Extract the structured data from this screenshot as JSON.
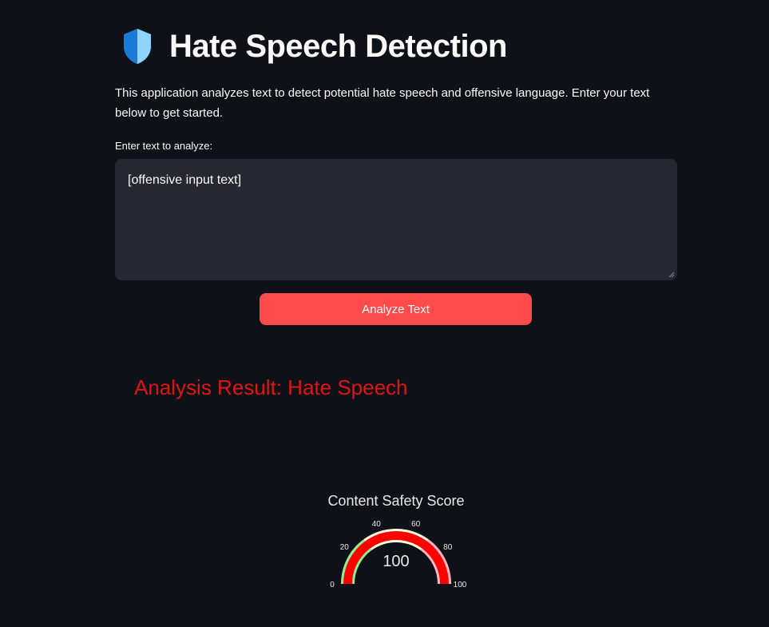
{
  "header": {
    "title": "Hate Speech Detection",
    "icon": "shield-icon"
  },
  "intro": "This application analyzes text to detect potential hate speech and offensive language. Enter your text below to get started.",
  "input": {
    "label": "Enter text to analyze:",
    "value": "[offensive input text]"
  },
  "button": {
    "label": "Analyze Text"
  },
  "result": {
    "text": "Analysis Result: Hate Speech"
  },
  "colors": {
    "accent": "#ff4b4b",
    "result": "#e01414",
    "bg": "#0e1117",
    "input_bg": "#262730"
  },
  "chart_data": {
    "type": "gauge",
    "title": "Content Safety Score",
    "value": 100,
    "range": [
      0,
      100
    ],
    "ticks": [
      0,
      20,
      40,
      60,
      80,
      100
    ],
    "bands": [
      {
        "from": 0,
        "to": 30,
        "color": "#90ee90"
      },
      {
        "from": 30,
        "to": 70,
        "color": "#ffffe0"
      },
      {
        "from": 70,
        "to": 100,
        "color": "#ffb6c1"
      }
    ],
    "bar_color": "#ff0000"
  }
}
